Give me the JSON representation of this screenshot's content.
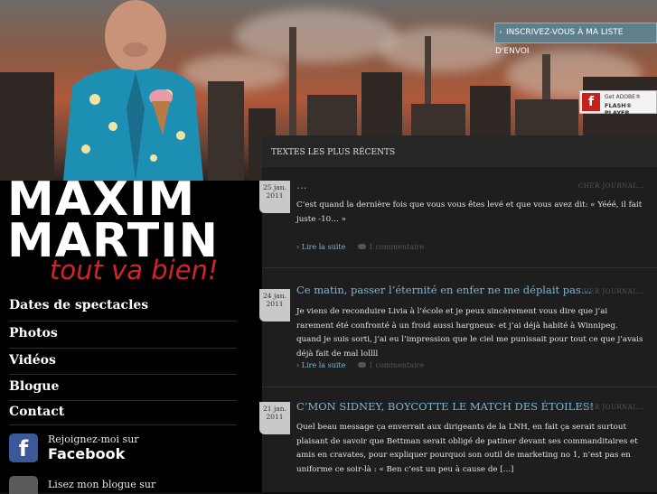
{
  "signup": {
    "label": "INSCRIVEZ-VOUS À MA LISTE D'ENVOI"
  },
  "flash": {
    "line1": "Get ADOBE®",
    "line2": "FLASH® PLAYER"
  },
  "logo": {
    "line1": "MAXIM",
    "line2": "MARTIN",
    "tagline": "tout va bien!"
  },
  "nav": {
    "items": [
      {
        "label": "Dates de spectacles"
      },
      {
        "label": "Photos"
      },
      {
        "label": "Vidéos"
      },
      {
        "label": "Blogue"
      },
      {
        "label": "Contact"
      }
    ]
  },
  "social": {
    "facebook": {
      "line1": "Rejoignez-moi sur",
      "line2": "Facebook"
    },
    "blog": {
      "line1": "Lisez mon blogue sur"
    }
  },
  "section": {
    "title": "TEXTES LES PLUS RÉCENTS"
  },
  "posts": [
    {
      "date_day": "25 jan.",
      "date_year": "2011",
      "title": "…",
      "category": "CHER JOURNAL…",
      "excerpt": "C’est quand la dernière fois que vous vous êtes levé et que vous avez dit: « Yééé, il fait juste -10… »",
      "more": "Lire la suite",
      "comments": "1 commentaire"
    },
    {
      "date_day": "24 jan.",
      "date_year": "2011",
      "title": "Ce matin, passer l’éternité en enfer ne me déplait pas…",
      "category": "CHER JOURNAL…",
      "excerpt": "Je viens de reconduire Livia à l’école et je peux sincèrement vous dire que j’ai rarement été confronté à un froid aussi hargneux- et j’ai déjà habité à Winnipeg. quand je suis sorti, j’ai eu l’impression que le ciel me punissait pour tout ce que j’avais déjà fait de mal lollll",
      "more": "Lire la suite",
      "comments": "1 commentaire"
    },
    {
      "date_day": "21 jan.",
      "date_year": "2011",
      "title": "C’MON SIDNEY, BOYCOTTE LE MATCH DES ÉTOILES!",
      "category": "CHER JOURNAL…",
      "excerpt": "Quel beau message ça enverrait aux dirigeants de la LNH, en fait ça serait surtout plaisant de savoir que Bettman serait obligé de patiner devant ses commanditaires et amis en cravates, pour expliquer pourquoi son outil de marketing no 1, n’est pas en uniforme ce soir-là : « Ben c’est un peu à cause de [...]"
    }
  ]
}
